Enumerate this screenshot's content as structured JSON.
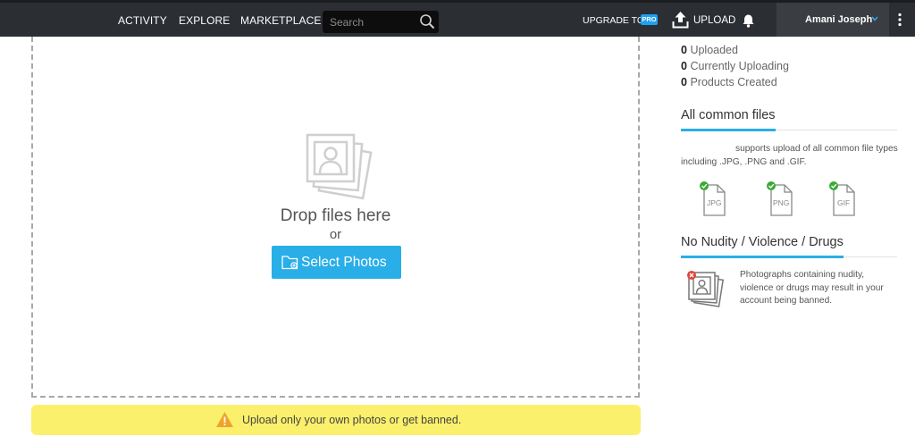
{
  "nav": {
    "items": [
      "ACTIVITY",
      "EXPLORE",
      "MARKETPLACE"
    ],
    "search_placeholder": "Search",
    "upgrade_label": "UPGRADE TO",
    "pro_badge": "PRO",
    "upload_label": "UPLOAD",
    "user_name": "Amani Joseph"
  },
  "dropzone": {
    "drop_text": "Drop files here",
    "or_text": "or",
    "select_label": "Select Photos"
  },
  "warning": {
    "text": "Upload only your own photos or get banned."
  },
  "stats": [
    {
      "count": "0",
      "label": "Uploaded"
    },
    {
      "count": "0",
      "label": "Currently Uploading"
    },
    {
      "count": "0",
      "label": "Products Created"
    }
  ],
  "common_files": {
    "title": "All common files",
    "line1": "supports upload of all common file types",
    "line2": "including .JPG, .PNG and .GIF.",
    "types": [
      "JPG",
      "PNG",
      "GIF"
    ]
  },
  "nudity": {
    "title": "No Nudity / Violence / Drugs",
    "line1": "Photographs containing nudity,",
    "line2": "violence or drugs may result in your",
    "line3": "account being banned."
  },
  "colors": {
    "topbar": "#2b2e33",
    "accent": "#29aee8",
    "warning_bg": "#fbf06b",
    "check_green": "#3aaa35",
    "ban_red": "#e0443a"
  }
}
